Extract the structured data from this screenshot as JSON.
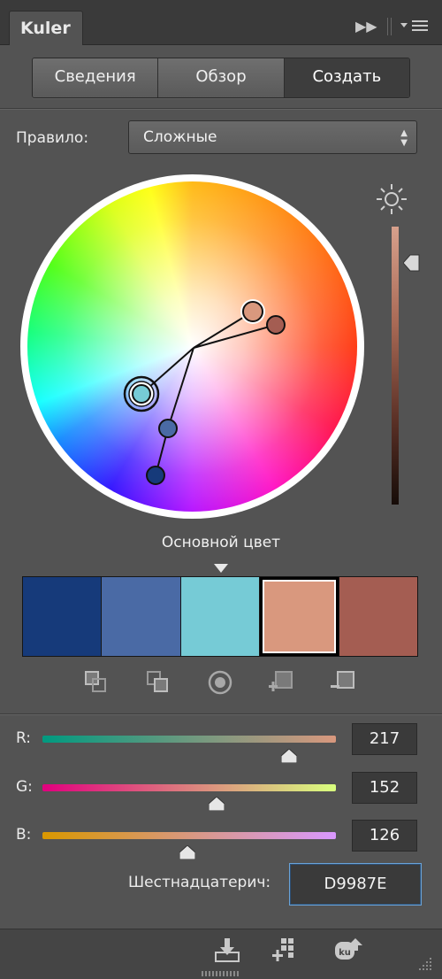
{
  "panel": {
    "title": "Kuler"
  },
  "tabs": [
    {
      "label": "Сведения",
      "active": false
    },
    {
      "label": "Обзор",
      "active": false
    },
    {
      "label": "Создать",
      "active": true
    }
  ],
  "rule": {
    "label": "Правило:",
    "value": "Сложные"
  },
  "base_color_label": "Основной цвет",
  "swatches": [
    {
      "color": "#163a7a"
    },
    {
      "color": "#4a6aa5"
    },
    {
      "color": "#76cbd6"
    },
    {
      "color": "#d9987e",
      "selected": true
    },
    {
      "color": "#a45d52"
    }
  ],
  "channels": {
    "r": {
      "label": "R:",
      "value": "217"
    },
    "g": {
      "label": "G:",
      "value": "152"
    },
    "b": {
      "label": "B:",
      "value": "126"
    }
  },
  "hex": {
    "label": "Шестнадцатерич:",
    "value": "D9987E"
  },
  "brightness_level": 0.13,
  "icons": [
    "fast-forward-icon",
    "panel-menu-icon",
    "sun-icon",
    "caret-down-icon",
    "swatch-tool-1-icon",
    "swatch-tool-2-icon",
    "target-icon",
    "add-swatch-icon",
    "remove-swatch-icon",
    "save-download-icon",
    "add-to-swatches-icon",
    "upload-kuler-icon",
    "resize-grip-icon"
  ]
}
